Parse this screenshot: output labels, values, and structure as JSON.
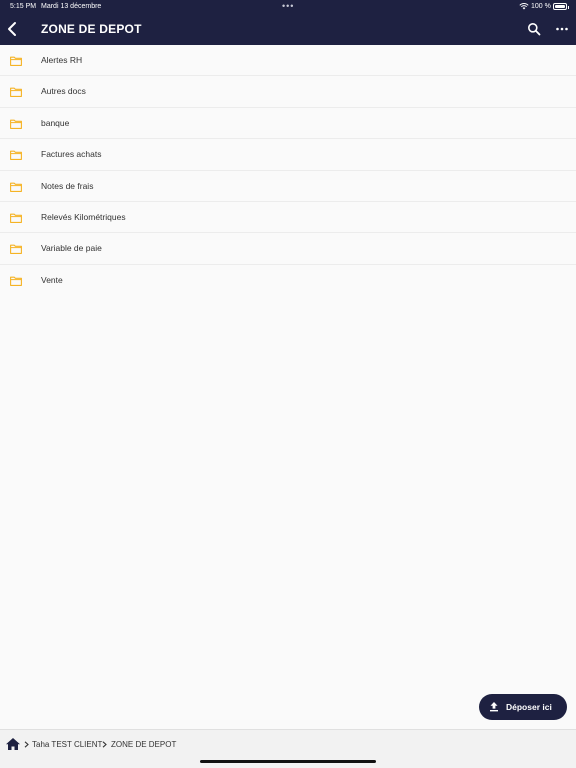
{
  "status_bar": {
    "time": "5:15 PM",
    "date": "Mardi 13 décembre",
    "multitask_dots": "•••",
    "battery_percent": "100 %"
  },
  "header": {
    "title": "ZONE DE DEPOT",
    "back_icon": "chevron-left-icon",
    "search_icon": "search-icon",
    "more_icon": "more-horizontal-icon"
  },
  "folders": [
    {
      "label": "Alertes RH"
    },
    {
      "label": "Autres docs"
    },
    {
      "label": "banque"
    },
    {
      "label": "Factures achats"
    },
    {
      "label": "Notes de frais"
    },
    {
      "label": "Relevés Kilométriques"
    },
    {
      "label": "Variable de paie"
    },
    {
      "label": "Vente"
    }
  ],
  "upload_button": {
    "label": "Déposer ici",
    "icon": "upload-icon"
  },
  "breadcrumb": {
    "items": [
      "Taha TEST CLIENT",
      "ZONE DE DEPOT"
    ],
    "home_icon": "home-icon"
  },
  "colors": {
    "header_bg": "#1e2141",
    "folder_icon": "#f5b324",
    "page_bg": "#fafafa"
  }
}
